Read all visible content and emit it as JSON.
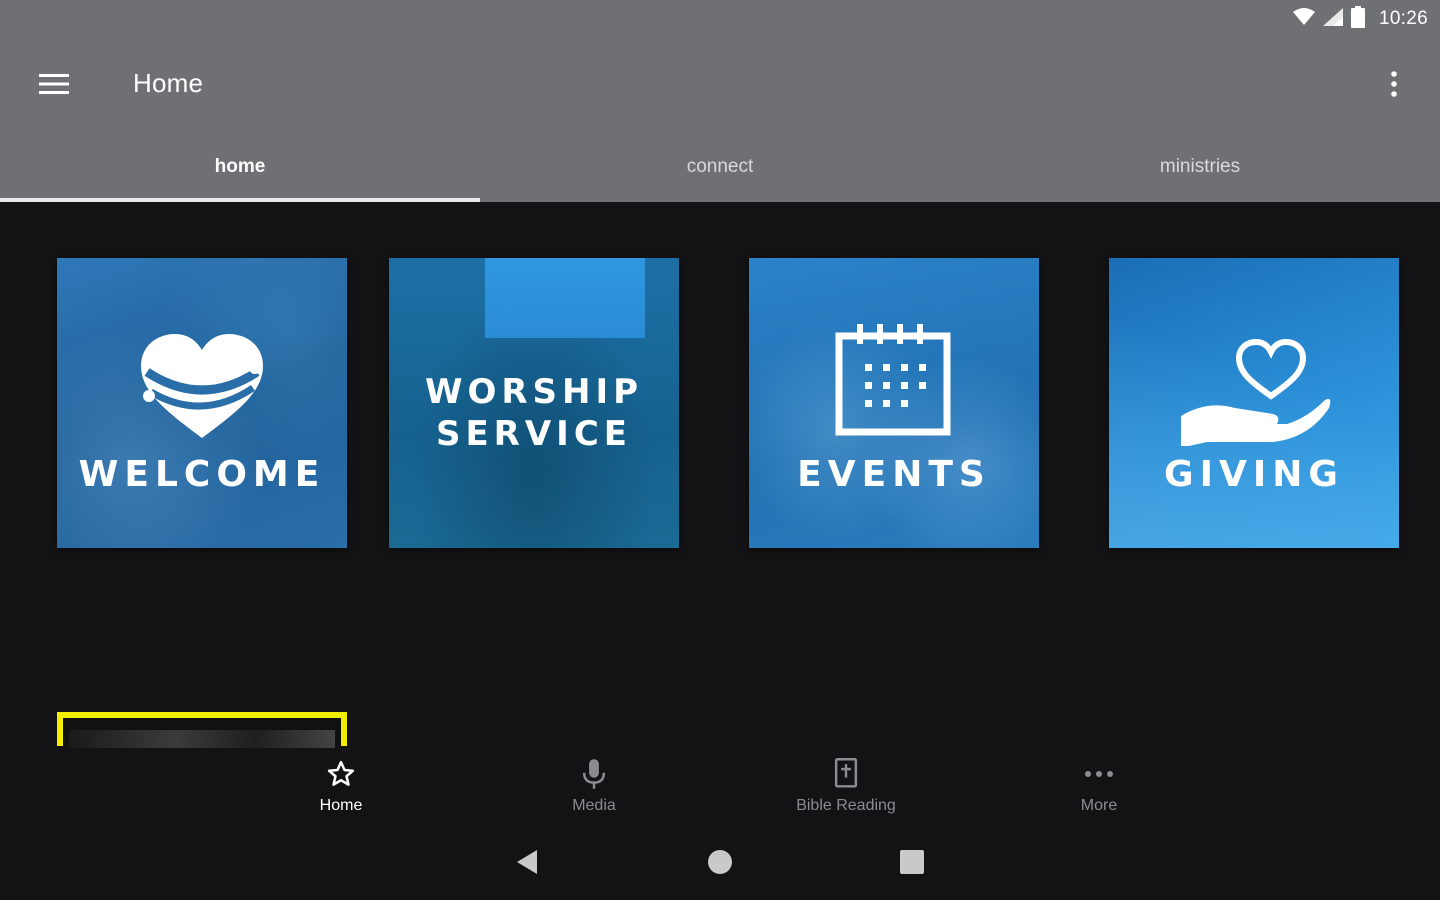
{
  "status_bar": {
    "time": "10:26",
    "icons": [
      "wifi-icon",
      "signal-icon",
      "battery-icon"
    ]
  },
  "app_bar": {
    "title": "Home",
    "menu_icon": "hamburger-menu-icon",
    "overflow_icon": "overflow-menu-icon"
  },
  "tabs": [
    {
      "label": "home",
      "active": true
    },
    {
      "label": "connect",
      "active": false
    },
    {
      "label": "ministries",
      "active": false
    }
  ],
  "tiles": {
    "welcome": {
      "label": "WELCOME",
      "icon": "heart-hug-icon"
    },
    "worship": {
      "label_line1": "WORSHIP",
      "label_line2": "SERVICE"
    },
    "events": {
      "label": "EVENTS",
      "icon": "calendar-icon"
    },
    "giving": {
      "label": "GIVING",
      "icon": "heart-hand-icon"
    }
  },
  "bottom_nav": [
    {
      "label": "Home",
      "icon": "star-icon",
      "active": true
    },
    {
      "label": "Media",
      "icon": "microphone-icon",
      "active": false
    },
    {
      "label": "Bible Reading",
      "icon": "bible-icon",
      "active": false
    },
    {
      "label": "More",
      "icon": "more-dots-icon",
      "active": false
    }
  ],
  "system_nav": [
    "back-icon",
    "home-circle-icon",
    "recents-square-icon"
  ],
  "colors": {
    "app_bar": "#6f7073",
    "background": "#131316",
    "tile_blue": "#2070b2",
    "highlight": "#f2f000"
  }
}
